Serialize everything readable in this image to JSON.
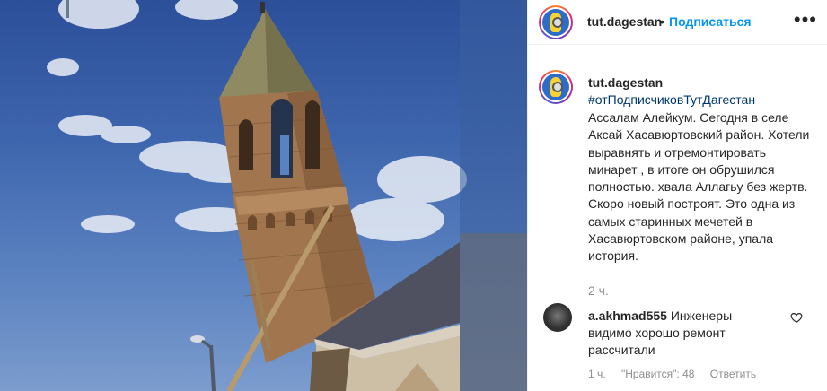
{
  "post": {
    "username": "tut.dagestan",
    "separator": "•",
    "follow_label": "Подписаться",
    "more_icon": "more-horizontal-icon"
  },
  "caption": {
    "username": "tut.dagestan",
    "hashtag": "#отПодписчиковТутДагестан",
    "text": "Ассалам Алейкум. Сегодня в селе Аксай Хасавюртовский район. Хотели выравнять и отремонтировать минарет , в итоге он обрушился полностью. хвала Аллагьу без жертв. Скоро новый построят. Это одна из самых старинных мечетей в Хасавюртовском районе, упала история.",
    "time": "2 ч."
  },
  "comment": {
    "username": "a.akhmad555",
    "text": "Инженеры видимо хорошо ремонт рассчитали",
    "time": "1 ч.",
    "likes": "\"Нравится\": 48",
    "reply_label": "Ответить",
    "heart_icon": "heart-outline-icon"
  },
  "colors": {
    "link": "#00376b",
    "follow": "#0095f6",
    "muted": "#8e8e8e",
    "text": "#262626"
  }
}
